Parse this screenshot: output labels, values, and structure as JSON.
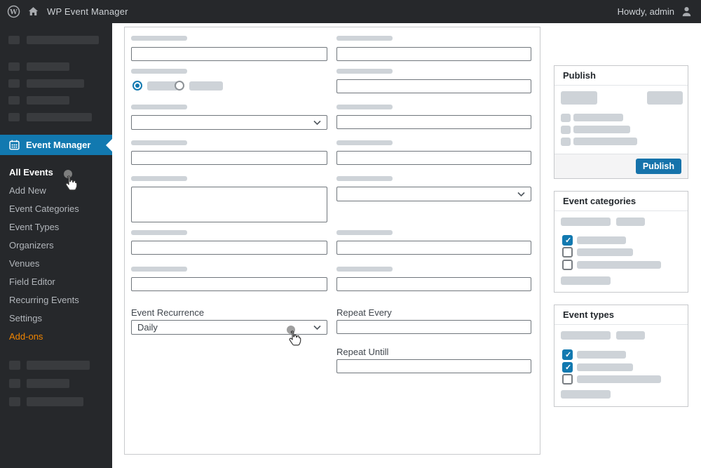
{
  "admin_bar": {
    "site_title": "WP Event Manager",
    "howdy_text": "Howdy, admin"
  },
  "sidebar": {
    "event_manager_label": "Event Manager",
    "submenu": [
      {
        "label": "All Events",
        "current": true
      },
      {
        "label": "Add New"
      },
      {
        "label": "Event Categories"
      },
      {
        "label": "Event Types"
      },
      {
        "label": "Organizers"
      },
      {
        "label": "Venues"
      },
      {
        "label": "Field Editor"
      },
      {
        "label": "Recurring Events"
      },
      {
        "label": "Settings"
      },
      {
        "label": "Add-ons"
      }
    ]
  },
  "form": {
    "type_radios": [
      {
        "checked": true
      },
      {
        "checked": false
      }
    ],
    "event_recurrence": {
      "label": "Event Recurrence",
      "value": "Daily"
    },
    "repeat_every": {
      "label": "Repeat Every",
      "value": ""
    },
    "repeat_untill": {
      "label": "Repeat Untill",
      "value": ""
    }
  },
  "publish_box": {
    "title": "Publish",
    "publish_button_label": "Publish"
  },
  "categories_box": {
    "title": "Event categories",
    "items": [
      {
        "checked": true
      },
      {
        "checked": false
      },
      {
        "checked": false
      }
    ]
  },
  "types_box": {
    "title": "Event types",
    "items": [
      {
        "checked": true
      },
      {
        "checked": true
      },
      {
        "checked": false
      }
    ]
  },
  "icons": {
    "admin_bar": [
      "wordpress-logo-icon",
      "home-icon",
      "user-icon"
    ],
    "sidebar": [
      "calendar-icon"
    ],
    "overlay": [
      "hand-cursor-icon",
      "click-indicator-dot"
    ]
  },
  "colors": {
    "accent_blue": "#1279b0",
    "button_blue": "#1673ab",
    "addons_orange": "#f18500",
    "dark_bg": "#26282b",
    "skeleton_light": "#ced3d8",
    "skeleton_dark": "#393b3e"
  }
}
